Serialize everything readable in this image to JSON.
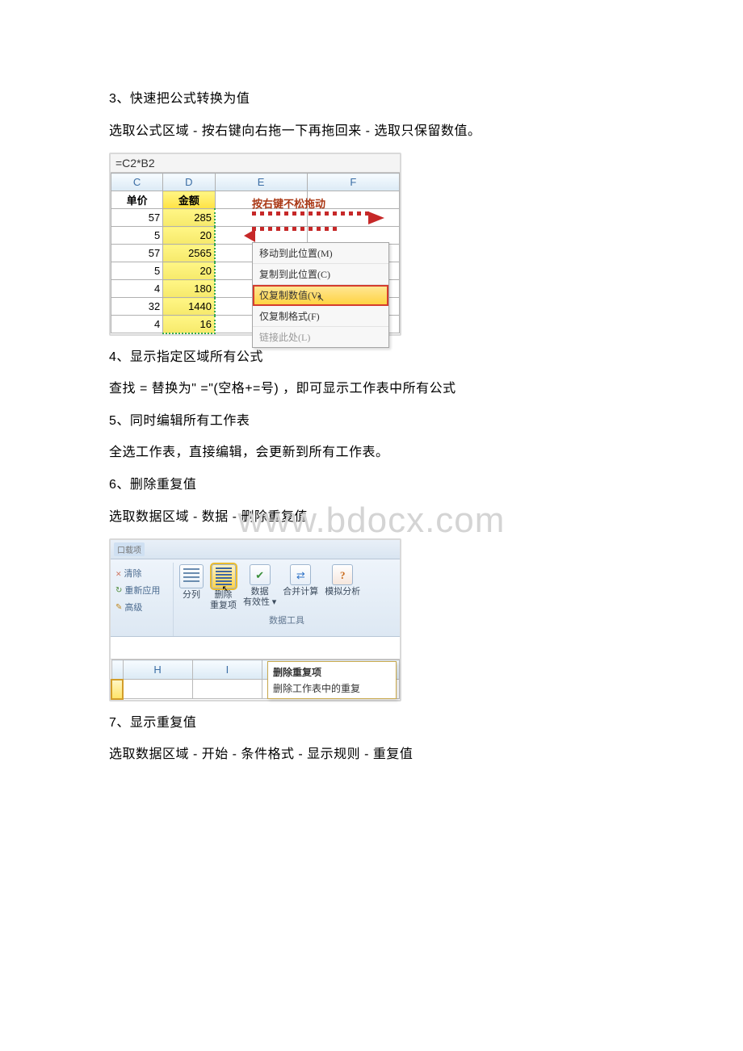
{
  "watermark": "www.bdocx.com",
  "paras": {
    "p1": "3、快速把公式转换为值",
    "p2": "选取公式区域 - 按右键向右拖一下再拖回来 - 选取只保留数值。",
    "p3": "4、显示指定区域所有公式",
    "p4": "查找 = 替换为\" =\"(空格+=号) ，即可显示工作表中所有公式",
    "p5": "5、同时编辑所有工作表",
    "p6": "全选工作表，直接编辑，会更新到所有工作表。",
    "p7": "6、删除重复值",
    "p8": "选取数据区域 - 数据 - 删除重复值",
    "p9": "7、显示重复值",
    "p10": "选取数据区域 - 开始 - 条件格式 - 显示规则 - 重复值"
  },
  "fig1": {
    "formula": "=C2*B2",
    "cols": {
      "C": "C",
      "D": "D",
      "E": "E",
      "F": "F"
    },
    "headers": {
      "c": "单价",
      "d": "金额"
    },
    "rows": [
      {
        "c": "57",
        "d": "285"
      },
      {
        "c": "5",
        "d": "20"
      },
      {
        "c": "57",
        "d": "2565"
      },
      {
        "c": "5",
        "d": "20"
      },
      {
        "c": "4",
        "d": "180"
      },
      {
        "c": "32",
        "d": "1440"
      },
      {
        "c": "4",
        "d": "16"
      }
    ],
    "drag_hint": "按右键不松拖动",
    "menu": {
      "m1": "移动到此位置(M)",
      "m2": "复制到此位置(C)",
      "m3": "仅复制数值(V)",
      "m4": "仅复制格式(F)",
      "m5": "链接此处(L)"
    }
  },
  "fig2": {
    "badge": "口载项",
    "filter": {
      "clear": "清除",
      "reapply": "重新应用",
      "adv": "高级"
    },
    "tools": {
      "split1": "分列",
      "dup1": "删除",
      "dup2": "重复项",
      "valid1": "数据",
      "valid2": "有效性 ▾",
      "cons": "合并计算",
      "what": "模拟分析"
    },
    "group": "数据工具",
    "col_h": "H",
    "col_i": "I",
    "tooltip": {
      "title": "删除重复项",
      "desc": "删除工作表中的重复"
    }
  }
}
